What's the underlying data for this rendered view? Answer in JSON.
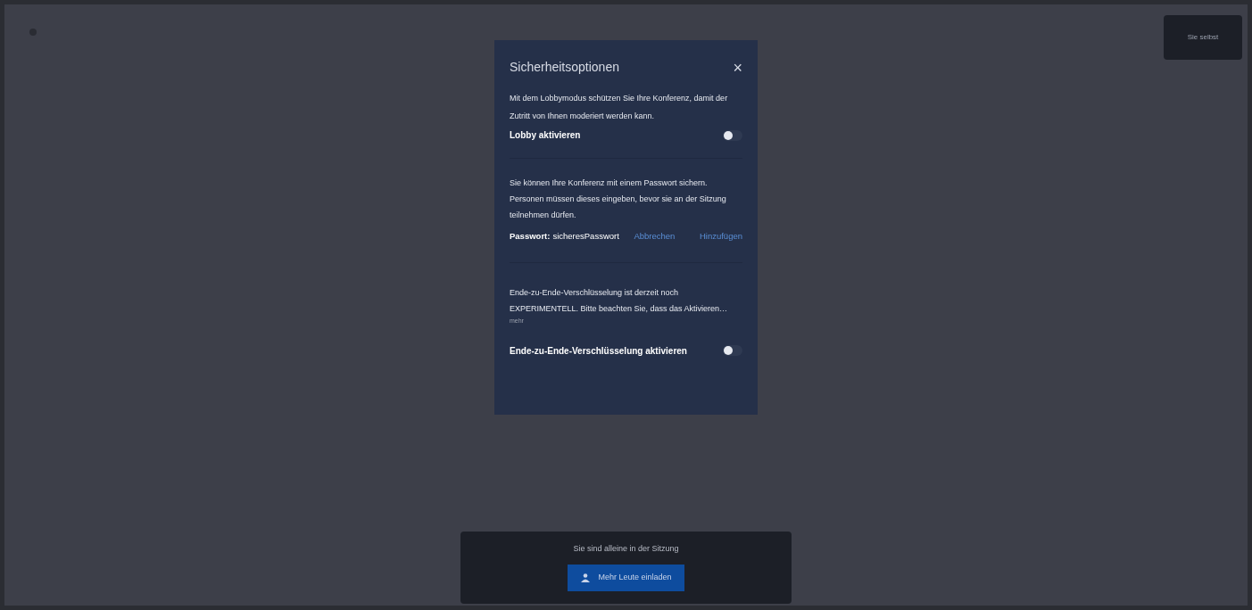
{
  "self_tile": {
    "label": "Sie selbst"
  },
  "dialog": {
    "title": "Sicherheitsoptionen",
    "close": "×",
    "lobby": {
      "description": "Mit dem Lobbymodus schützen Sie Ihre Konferenz, damit der Zutritt von Ihnen moderiert werden kann.",
      "label": "Lobby aktivieren",
      "on": false
    },
    "password": {
      "description": "Sie können Ihre Konferenz mit einem Passwort sichern. Personen müssen dieses eingeben, bevor sie an der Sitzung teilnehmen dürfen.",
      "label": "Passwort:",
      "value": "sicheresPasswort",
      "cancel": "Abbrechen",
      "add": "Hinzufügen"
    },
    "e2ee": {
      "description": "Ende-zu-Ende-Verschlüsselung ist derzeit noch EXPERIMENTELL. Bitte beachten Sie, dass das Aktivieren…",
      "more": "mehr",
      "label": "Ende-zu-Ende-Verschlüsselung aktivieren",
      "on": false
    }
  },
  "notice": {
    "text": "Sie sind alleine in der Sitzung",
    "button": "Mehr Leute einladen"
  }
}
